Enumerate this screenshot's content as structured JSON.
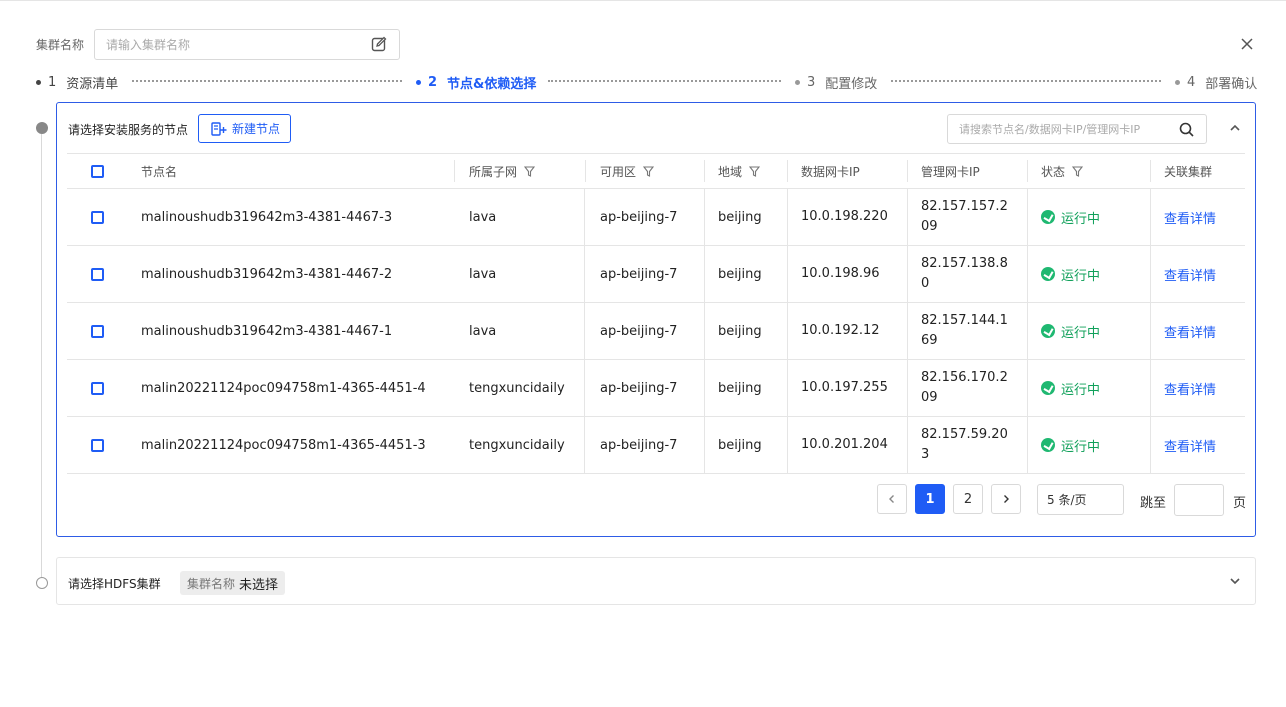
{
  "header": {
    "cluster_name_label": "集群名称",
    "cluster_name_placeholder": "请输入集群名称"
  },
  "steps": [
    {
      "num": "1",
      "label": "资源清单",
      "state": "done"
    },
    {
      "num": "2",
      "label": "节点&依赖选择",
      "state": "active"
    },
    {
      "num": "3",
      "label": "配置修改",
      "state": "todo"
    },
    {
      "num": "4",
      "label": "部署确认",
      "state": "todo"
    }
  ],
  "node_panel": {
    "title": "请选择安装服务的节点",
    "new_node_label": "新建节点",
    "search_placeholder": "请搜索节点名/数据网卡IP/管理网卡IP"
  },
  "table": {
    "columns": [
      "节点名",
      "所属子网",
      "可用区",
      "地域",
      "数据网卡IP",
      "管理网卡IP",
      "状态",
      "关联集群"
    ],
    "rows": [
      {
        "name": "malinoushudb319642m3-4381-4467-3",
        "subnet": "lava",
        "zone": "ap-beijing-7",
        "region": "beijing",
        "data_ip": "10.0.198.220",
        "mgmt_ip": "82.157.157.209",
        "status": "运行中",
        "link": "查看详情"
      },
      {
        "name": "malinoushudb319642m3-4381-4467-2",
        "subnet": "lava",
        "zone": "ap-beijing-7",
        "region": "beijing",
        "data_ip": "10.0.198.96",
        "mgmt_ip": "82.157.138.80",
        "status": "运行中",
        "link": "查看详情"
      },
      {
        "name": "malinoushudb319642m3-4381-4467-1",
        "subnet": "lava",
        "zone": "ap-beijing-7",
        "region": "beijing",
        "data_ip": "10.0.192.12",
        "mgmt_ip": "82.157.144.169",
        "status": "运行中",
        "link": "查看详情"
      },
      {
        "name": "malin20221124poc094758m1-4365-4451-4",
        "subnet": "tengxuncidaily",
        "zone": "ap-beijing-7",
        "region": "beijing",
        "data_ip": "10.0.197.255",
        "mgmt_ip": "82.156.170.209",
        "status": "运行中",
        "link": "查看详情"
      },
      {
        "name": "malin20221124poc094758m1-4365-4451-3",
        "subnet": "tengxuncidaily",
        "zone": "ap-beijing-7",
        "region": "beijing",
        "data_ip": "10.0.201.204",
        "mgmt_ip": "82.157.59.203",
        "status": "运行中",
        "link": "查看详情"
      }
    ]
  },
  "pagination": {
    "pages": [
      "1",
      "2"
    ],
    "current": "1",
    "page_size": "5 条/页",
    "jump_label": "跳至",
    "page_unit": "页"
  },
  "hdfs_panel": {
    "title": "请选择HDFS集群",
    "tag_key": "集群名称",
    "tag_value": "未选择"
  },
  "colors": {
    "primary": "#1f5cf5",
    "status_running": "#10a05a"
  }
}
